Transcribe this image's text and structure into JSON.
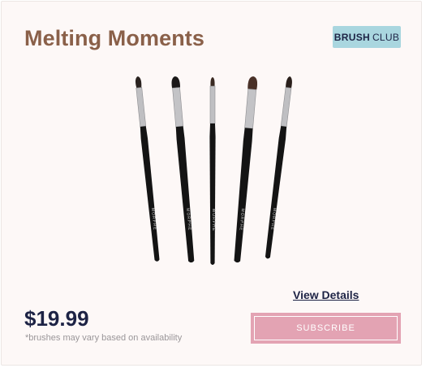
{
  "product": {
    "title": "Melting Moments",
    "badge_bold": "BRUSH",
    "badge_regular": "CLUB",
    "image_icon": "makeup-brushes-image",
    "brush_count": 5,
    "brush_brand": "MORPHE",
    "details_link": "View Details",
    "price": "$19.99",
    "disclaimer": "*brushes may vary based on availability",
    "subscribe_label": "SUBSCRIBE"
  },
  "colors": {
    "background": "#fdf8f7",
    "title": "#8a6049",
    "badge": "#a9d6df",
    "navy": "#1d2345",
    "subscribe": "#e3a3b3"
  }
}
